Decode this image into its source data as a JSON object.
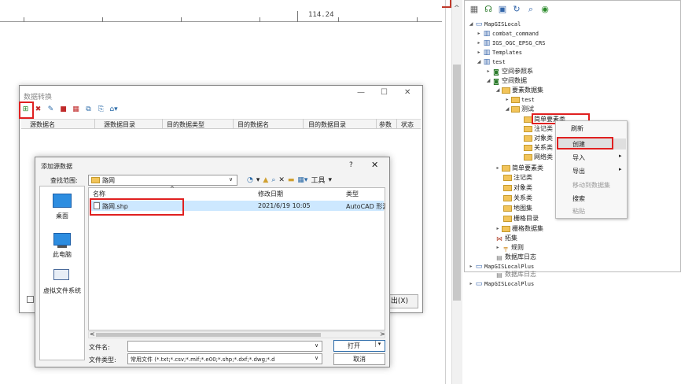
{
  "ruler": {
    "label": "114.24"
  },
  "scroll": {
    "up_arrow": "^"
  },
  "tree": {
    "rows": [
      {
        "label": "MapGISLocal"
      },
      {
        "label": "combat_command"
      },
      {
        "label": "IGS_OGC_EPSG_CRS"
      },
      {
        "label": "Templates"
      },
      {
        "label": "test"
      },
      {
        "label": "空间参照系"
      },
      {
        "label": "空间数据"
      },
      {
        "label": "要素数据集"
      },
      {
        "label": "test"
      },
      {
        "label": "测试"
      },
      {
        "label": "简单要素类"
      },
      {
        "label": "注记类"
      },
      {
        "label": "对象类"
      },
      {
        "label": "关系类"
      },
      {
        "label": "网络类"
      },
      {
        "label": "简单要素类"
      },
      {
        "label": "注记类"
      },
      {
        "label": "对象类"
      },
      {
        "label": "关系类"
      },
      {
        "label": "地图集"
      },
      {
        "label": "栅格目录"
      },
      {
        "label": "栅格数据集"
      },
      {
        "label": "拓集"
      },
      {
        "label": "规则"
      },
      {
        "label": "数据库日志"
      },
      {
        "label": "MapGISLocalPlus"
      },
      {
        "label": "数据库日志"
      },
      {
        "label": "MapGISLocalPlus"
      }
    ]
  },
  "context_menu": {
    "refresh": "刷新",
    "create": "创建",
    "import": "导入",
    "export": "导出",
    "move_to_dataset": "移动到数据集",
    "search": "搜索",
    "paste": "粘贴"
  },
  "data_convert": {
    "title": "数据转换",
    "minimize": "—",
    "maximize": "☐",
    "close": "✕",
    "columns": [
      "源数据名",
      "源数据目录",
      "目的数据类型",
      "目的数据名",
      "目的数据目录",
      "参数",
      "状态"
    ],
    "exit_button": "出(X)"
  },
  "add_source": {
    "title": "添加源数据",
    "help": "?",
    "close": "✕",
    "look_in_label": "查找范围:",
    "look_in_value": "路网",
    "tools_label": "工具",
    "places": [
      "桌面",
      "此电脑",
      "虚拟文件系统"
    ],
    "col_name": "名称",
    "col_date": "修改日期",
    "col_type": "类型",
    "file": {
      "name": "路网.shp",
      "date": "2021/6/19 10:05",
      "type": "AutoCAD 形源"
    },
    "filename_label": "文件名:",
    "filename_value": "",
    "filetype_label": "文件类型:",
    "filetype_value": "常用文件 (*.txt;*.csv;*.mif;*.e00;*.shp;*.dxf;*.dwg;*.d",
    "open_button": "打开",
    "cancel_button": "取消"
  }
}
